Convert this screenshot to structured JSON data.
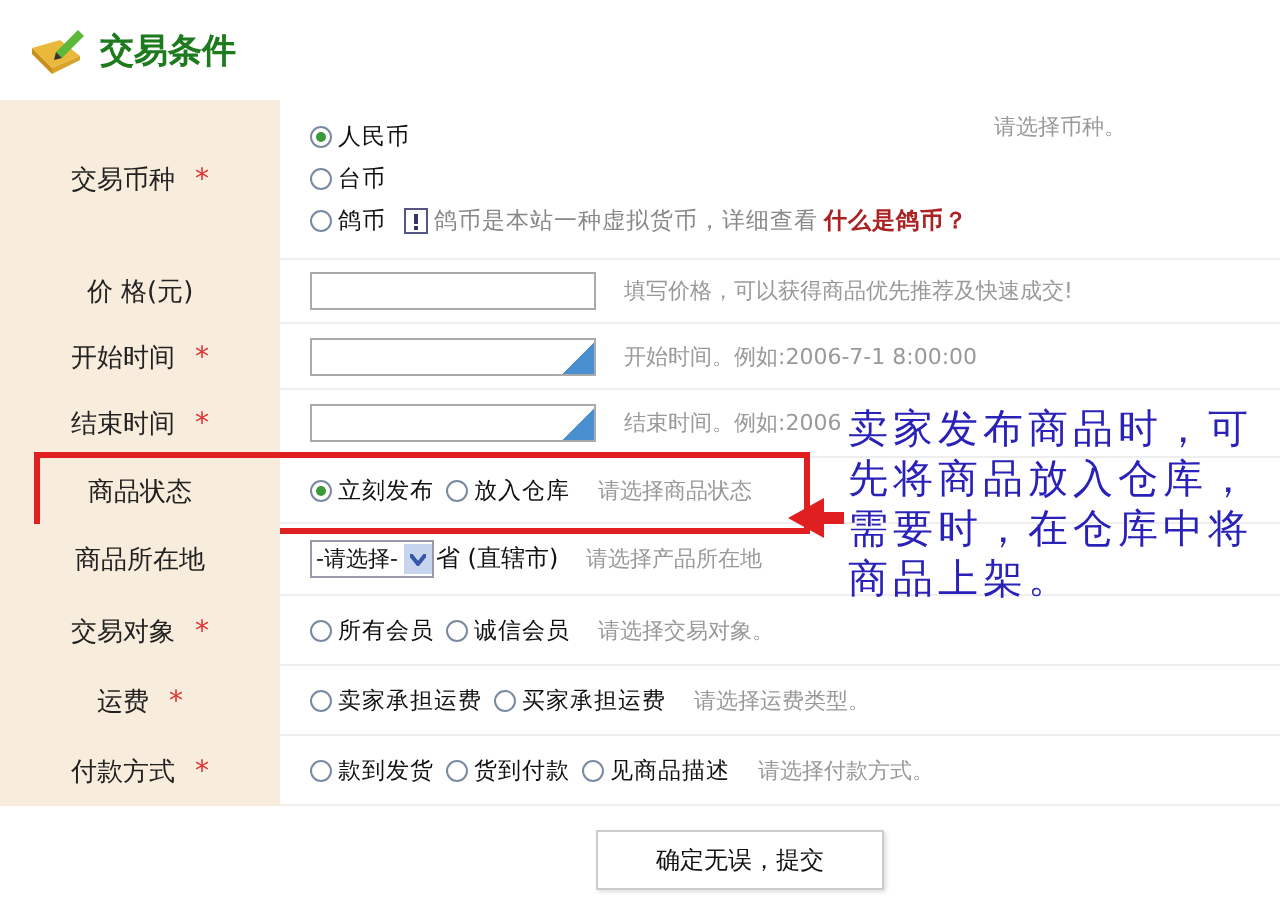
{
  "header": {
    "title": "交易条件"
  },
  "rows": [
    {
      "label": "交易币种",
      "mark": "*",
      "highlighted": false,
      "kind": "radio-stack",
      "hint": "请选择币种。",
      "options": [
        {
          "label": "人民币",
          "selected": true
        },
        {
          "label": "台币",
          "selected": false
        },
        {
          "label": "鸽币",
          "selected": false
        }
      ],
      "note": {
        "text": "鸽币是本站一种虚拟货币，详细查看",
        "link": "什么是鸽币？"
      }
    },
    {
      "label": "价 格(元)",
      "highlighted": false,
      "kind": "text",
      "hint": "填写价格，可以获得商品优先推荐及快速成交!"
    },
    {
      "label": "开始时间",
      "mark": "*",
      "highlighted": false,
      "kind": "date",
      "hint": "开始时间。例如:2006-7-1 8:00:00"
    },
    {
      "label": "结束时间",
      "mark": "*",
      "highlighted": false,
      "kind": "date",
      "hint": "结束时间。例如:2006"
    },
    {
      "label": "商品状态",
      "highlighted": true,
      "kind": "radios",
      "hint": "请选择商品状态",
      "options": [
        {
          "label": "立刻发布",
          "selected": true
        },
        {
          "label": "放入仓库",
          "selected": false
        }
      ]
    },
    {
      "label": "商品所在地",
      "highlighted": false,
      "kind": "select",
      "value": "-请选择-",
      "suffix": "省 (直辖市)",
      "hint": "请选择产品所在地"
    },
    {
      "label": "交易对象",
      "mark": "*",
      "highlighted": false,
      "kind": "radios",
      "hint": "请选择交易对象。",
      "options": [
        {
          "label": "所有会员",
          "selected": false
        },
        {
          "label": "诚信会员",
          "selected": false
        }
      ]
    },
    {
      "label": "运费",
      "mark": "*",
      "highlighted": false,
      "kind": "radios",
      "hint": "请选择运费类型。",
      "options": [
        {
          "label": "卖家承担运费",
          "selected": false
        },
        {
          "label": "买家承担运费",
          "selected": false
        }
      ]
    },
    {
      "label": "付款方式",
      "mark": "*",
      "highlighted": false,
      "kind": "radios",
      "hint": "请选择付款方式。",
      "options": [
        {
          "label": "款到发货",
          "selected": false
        },
        {
          "label": "货到付款",
          "selected": false
        },
        {
          "label": "见商品描述",
          "selected": false
        }
      ]
    }
  ],
  "submit": {
    "label": "确定无误，提交"
  },
  "annotation": {
    "text": "卖家发布商品时，可先将商品放入仓库，需要时，在仓库中将商品上架。"
  }
}
